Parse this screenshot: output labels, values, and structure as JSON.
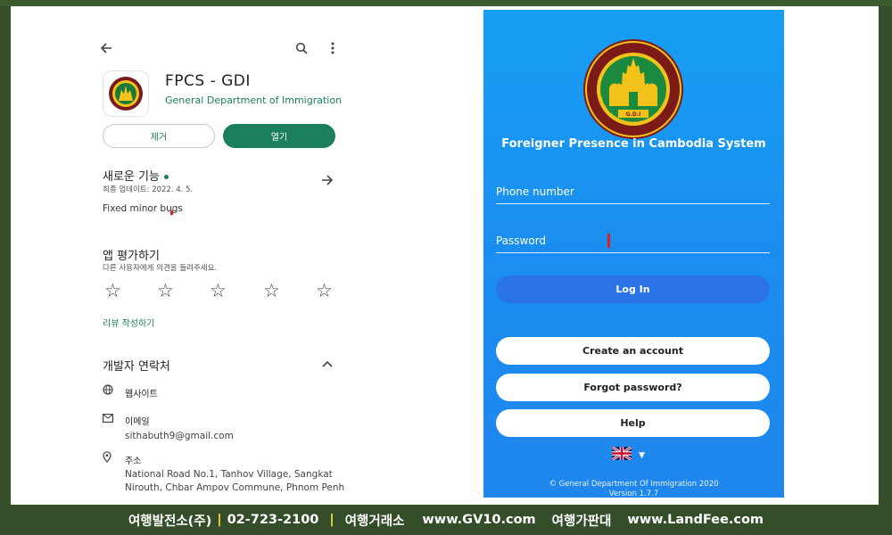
{
  "left": {
    "app": {
      "title": "FPCS - GDI",
      "developer": "General Department of Immigration",
      "remove_label": "제거",
      "open_label": "열기"
    },
    "whats_new": {
      "title": "새로운 기능",
      "updated": "최종 업데이트: 2022. 4. 5.",
      "text": "Fixed minor bugs"
    },
    "rate": {
      "title": "앱 평가하기",
      "subtitle": "다른 사용자에게 의견을 들려주세요.",
      "stars": 5,
      "review_link": "리뷰 작성하기"
    },
    "contact": {
      "title": "개발자 연락처",
      "website_label": "웹사이트",
      "email_label": "이메일",
      "email_value": "sithabuth9@gmail.com",
      "address_label": "주소",
      "address_value": "National Road No.1, Tanhov Village, Sangkat Nirouth, Chbar Ampov Commune, Phnom Penh"
    },
    "icons": [
      "back-arrow-icon",
      "search-icon",
      "more-vert-icon",
      "arrow-right-icon",
      "chevron-up-icon",
      "globe-icon",
      "mail-icon",
      "location-pin-icon",
      "star-outline-icon"
    ],
    "accent": "#1a7f5a"
  },
  "phone": {
    "title": "Foreigner Presence in Cambodia System",
    "phone_placeholder": "Phone number",
    "password_placeholder": "Password",
    "login_label": "Log In",
    "create_account_label": "Create an account",
    "forgot_password_label": "Forgot password?",
    "help_label": "Help",
    "copyright": "© General Department Of Immigration 2020",
    "version": "Version 1.7.7",
    "seal_text": "G.D.I",
    "seal_ring_text": "GENERAL DEPARTMENT OF IMMIGRATION",
    "background": "#1a8ff0"
  },
  "footer": {
    "company": "여행발전소(주)",
    "phone": "02-723-2100",
    "label1": "여행거래소",
    "site1": "www.GV10.com",
    "label2": "여행가판대",
    "site2": "www.LandFee.com",
    "separator": "|"
  }
}
